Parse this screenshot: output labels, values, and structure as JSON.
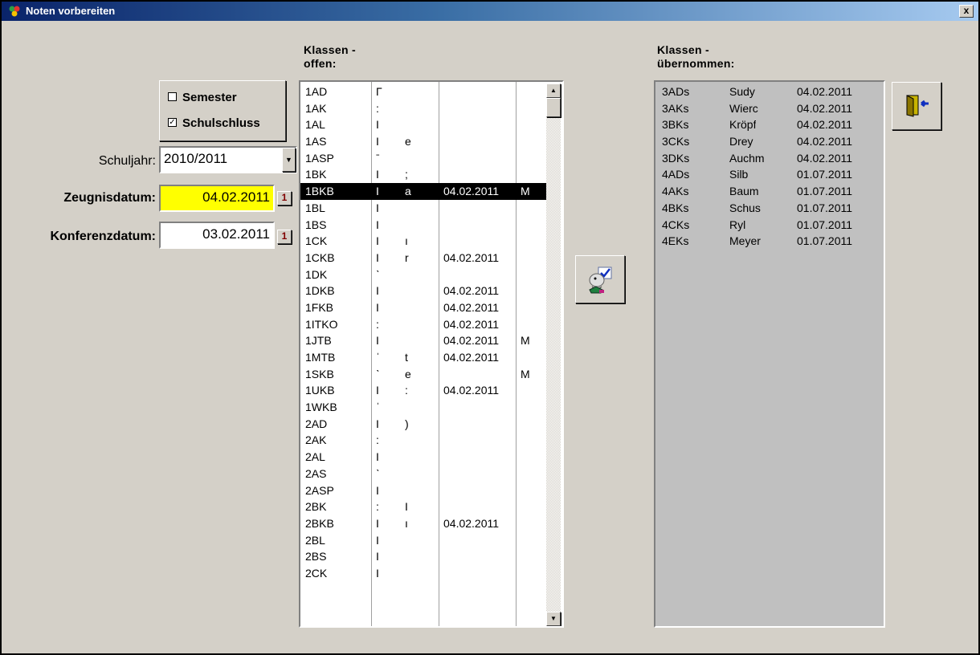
{
  "window": {
    "title": "Noten vorbereiten",
    "close_label": "x"
  },
  "headers": {
    "open_line1": "Klassen -",
    "open_line2": "offen:",
    "done_line1": "Klassen -",
    "done_line2": "übernommen:"
  },
  "checkboxes": [
    {
      "label": "Semester",
      "checked": false,
      "mark": ""
    },
    {
      "label": "Schulschluss",
      "checked": true,
      "mark": "✓"
    }
  ],
  "form": {
    "schuljahr_label": "Schuljahr:",
    "schuljahr_value": "2010/2011",
    "zeugnis_label": "Zeugnisdatum:",
    "zeugnis_value": "04.02.2011",
    "konferenz_label": "Konferenzdatum:",
    "konferenz_value": "03.02.2011",
    "calendar_glyph": "1"
  },
  "open_classes": [
    [
      "1AD",
      "Γ",
      "",
      "",
      ""
    ],
    [
      "1AK",
      ":",
      "",
      "",
      ""
    ],
    [
      "1AL",
      "I",
      "",
      "",
      ""
    ],
    [
      "1AS",
      "I",
      "e",
      "",
      ""
    ],
    [
      "1ASP",
      "ˉ",
      "",
      "",
      ""
    ],
    [
      "1BK",
      "I",
      ";",
      "",
      ""
    ],
    [
      "1BKB",
      "I",
      "a",
      "04.02.2011",
      "M"
    ],
    [
      "1BL",
      "I",
      "",
      "",
      ""
    ],
    [
      "1BS",
      "I",
      "",
      "",
      ""
    ],
    [
      "1CK",
      "I",
      "ı",
      "",
      ""
    ],
    [
      "1CKB",
      "I",
      "r",
      "04.02.2011",
      ""
    ],
    [
      "1DK",
      "ˋ",
      "",
      "",
      ""
    ],
    [
      "1DKB",
      "I",
      "",
      "04.02.2011",
      ""
    ],
    [
      "1FKB",
      "I",
      "",
      "04.02.2011",
      ""
    ],
    [
      "1ITKO",
      ":",
      "",
      "04.02.2011",
      ""
    ],
    [
      "1JTB",
      "I",
      "",
      "04.02.2011",
      "M"
    ],
    [
      "1MTB",
      "ˈ",
      "t",
      "04.02.2011",
      ""
    ],
    [
      "1SKB",
      "ˋ",
      "e",
      "",
      "M"
    ],
    [
      "1UKB",
      "I",
      ":",
      "04.02.2011",
      ""
    ],
    [
      "1WKB",
      "ˈ",
      "",
      "",
      ""
    ],
    [
      "2AD",
      "I",
      ")",
      "",
      ""
    ],
    [
      "2AK",
      ":",
      "",
      "",
      ""
    ],
    [
      "2AL",
      "I",
      "",
      "",
      ""
    ],
    [
      "2AS",
      "ˋ",
      "",
      "",
      ""
    ],
    [
      "2ASP",
      "I",
      "",
      "",
      ""
    ],
    [
      "2BK",
      ":",
      "I",
      "",
      ""
    ],
    [
      "2BKB",
      "I",
      "ı",
      "04.02.2011",
      ""
    ],
    [
      "2BL",
      "I",
      "",
      "",
      ""
    ],
    [
      "2BS",
      "I",
      "",
      "",
      ""
    ],
    [
      "2CK",
      "I",
      "",
      "",
      ""
    ]
  ],
  "selected_index": 6,
  "done_classes": [
    [
      "3ADs",
      "Sudy",
      "04.02.2011"
    ],
    [
      "3AKs",
      "Wierc",
      "04.02.2011"
    ],
    [
      "3BKs",
      "Kröpf",
      "04.02.2011"
    ],
    [
      "3CKs",
      "Drey",
      "04.02.2011"
    ],
    [
      "3DKs",
      "Auchm",
      "04.02.2011"
    ],
    [
      "4ADs",
      "Silb",
      "01.07.2011"
    ],
    [
      "4AKs",
      "Baum",
      "01.07.2011"
    ],
    [
      "4BKs",
      "Schus",
      "01.07.2011"
    ],
    [
      "4CKs",
      "Ryl",
      "01.07.2011"
    ],
    [
      "4EKs",
      "Meyer",
      "01.07.2011"
    ]
  ],
  "icons": {
    "transfer": "transfer-icon",
    "exit": "exit-door-icon"
  }
}
